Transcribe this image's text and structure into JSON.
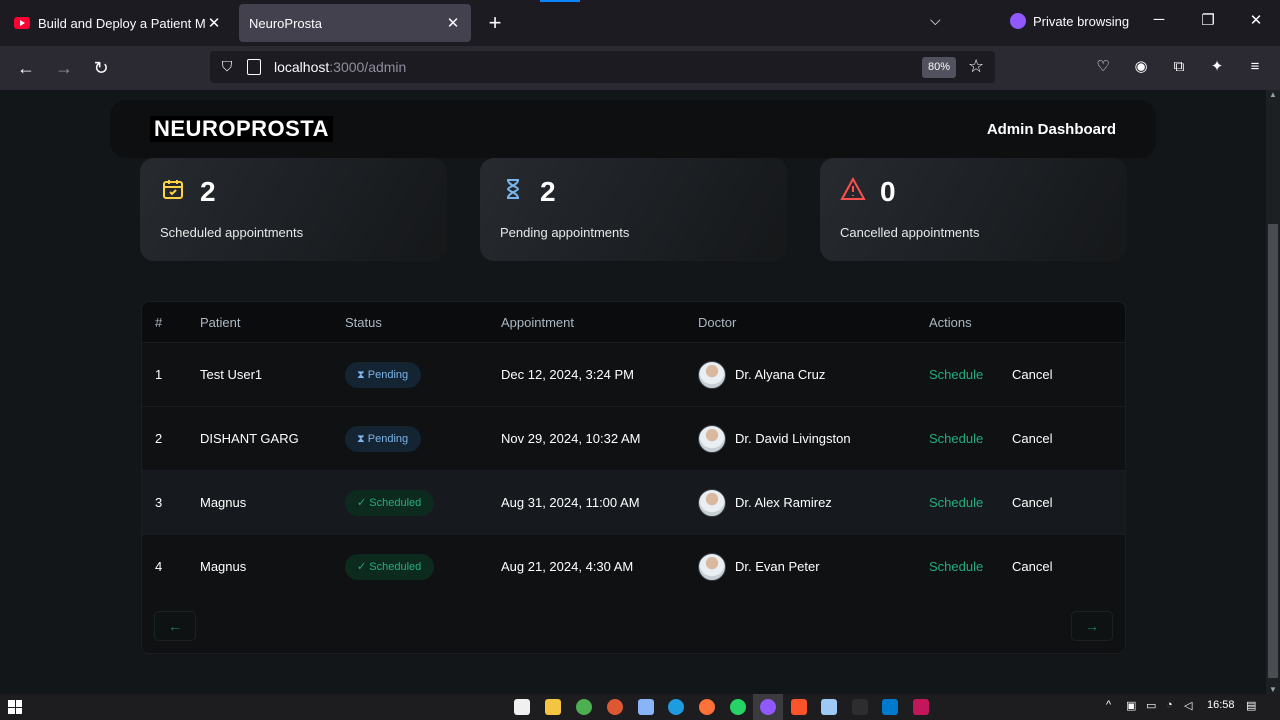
{
  "browser": {
    "tabs": [
      {
        "title": "Build and Deploy a Patient Mana",
        "close": "✕"
      },
      {
        "title": "NeuroProsta",
        "close": "✕"
      }
    ],
    "new_tab": "+",
    "private_label": "Private browsing",
    "url_host": "localhost",
    "url_rest": ":3000/admin",
    "zoom": "80%"
  },
  "header": {
    "logo": "NEUROPROSTA",
    "title": "Admin Dashboard"
  },
  "stats": [
    {
      "count": "2",
      "label": "Scheduled appointments",
      "icon": "calendar-check-icon",
      "color": "#ffd147"
    },
    {
      "count": "2",
      "label": "Pending appointments",
      "icon": "hourglass-icon",
      "color": "#79b5ec"
    },
    {
      "count": "0",
      "label": "Cancelled appointments",
      "icon": "alert-triangle-icon",
      "color": "#ff4f4e"
    }
  ],
  "table": {
    "columns": [
      "#",
      "Patient",
      "Status",
      "Appointment",
      "Doctor",
      "Actions"
    ],
    "rows": [
      {
        "num": "1",
        "patient": "Test User1",
        "status": "Pending",
        "date": "Dec 12, 2024, 3:24 PM",
        "doctor": "Dr. Alyana Cruz"
      },
      {
        "num": "2",
        "patient": "DISHANT GARG",
        "status": "Pending",
        "date": "Nov 29, 2024, 10:32 AM",
        "doctor": "Dr. David Livingston"
      },
      {
        "num": "3",
        "patient": "Magnus",
        "status": "Scheduled",
        "date": "Aug 31, 2024, 11:00 AM",
        "doctor": "Dr. Alex Ramirez"
      },
      {
        "num": "4",
        "patient": "Magnus",
        "status": "Scheduled",
        "date": "Aug 21, 2024, 4:30 AM",
        "doctor": "Dr. Evan Peter"
      }
    ],
    "action_schedule": "Schedule",
    "action_cancel": "Cancel",
    "pager_prev": "←",
    "pager_next": "→"
  },
  "taskbar": {
    "time": "16:58"
  },
  "colors": {
    "accent_green": "#24ae7c",
    "pending_blue": "#79b5ec",
    "danger_red": "#ff4f4e",
    "warning_yellow": "#ffd147"
  }
}
